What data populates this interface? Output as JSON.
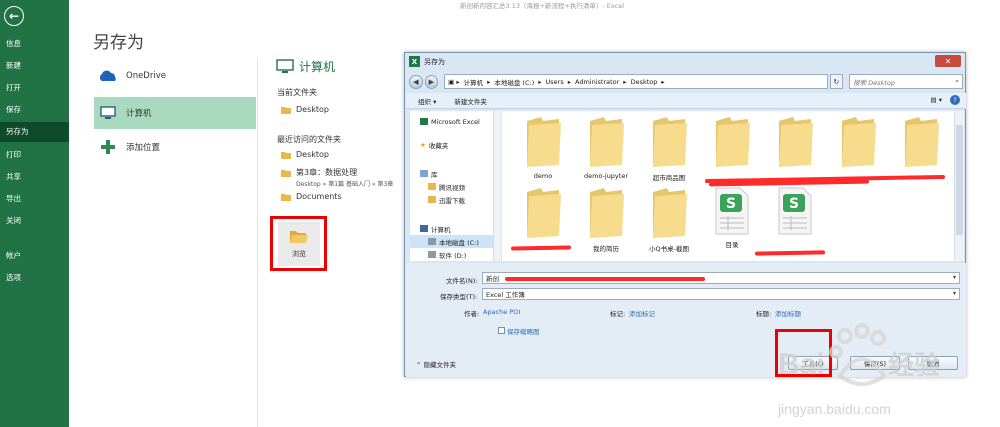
{
  "app": {
    "title": "新创新内容汇总3.13（海报+新流程+执行清单）- Excel",
    "page_title": "另存为"
  },
  "sidebar": {
    "items": [
      {
        "label": "信息"
      },
      {
        "label": "新建"
      },
      {
        "label": "打开"
      },
      {
        "label": "保存"
      },
      {
        "label": "另存为"
      },
      {
        "label": "打印"
      },
      {
        "label": "共享"
      },
      {
        "label": "导出"
      },
      {
        "label": "关闭"
      },
      {
        "label": "帐户"
      },
      {
        "label": "选项"
      }
    ],
    "active": "另存为"
  },
  "locations": [
    {
      "label": "OneDrive",
      "icon": "cloud-icon"
    },
    {
      "label": "计算机",
      "icon": "computer-icon"
    },
    {
      "label": "添加位置",
      "icon": "plus-icon"
    }
  ],
  "computer_pane": {
    "heading": "计算机",
    "current_folder_label": "当前文件夹",
    "current_folder": "Desktop",
    "recent_label": "最近访问的文件夹",
    "recent": [
      {
        "name": "Desktop"
      },
      {
        "name": "第3章：数据处理",
        "path": "Desktop » 第1篇 基础入门 » 第3章"
      },
      {
        "name": "Documents"
      }
    ],
    "browse_label": "浏览"
  },
  "dialog": {
    "title": "另存为",
    "address": [
      "计算机",
      "本地磁盘 (C:)",
      "Users",
      "Administrator",
      "Desktop"
    ],
    "search_placeholder": "搜索 Desktop",
    "toolbar": {
      "organize": "组织 ▾",
      "new_folder": "新建文件夹"
    },
    "tree": [
      {
        "label": "Microsoft Excel",
        "icon": "excel-icon",
        "indent": false
      },
      {
        "label": "收藏夹",
        "icon": "star-icon",
        "indent": false
      },
      {
        "label": "库",
        "icon": "library-icon",
        "indent": false
      },
      {
        "label": "腾讯视频",
        "icon": "folder-icon",
        "indent": true
      },
      {
        "label": "迅雷下载",
        "icon": "folder-icon",
        "indent": true
      },
      {
        "label": "计算机",
        "icon": "computer-icon",
        "indent": false
      },
      {
        "label": "本地磁盘 (C:)",
        "icon": "drive-icon",
        "indent": true,
        "selected": true
      },
      {
        "label": "软件 (D:)",
        "icon": "drive-icon",
        "indent": true
      }
    ],
    "files": [
      {
        "label": "demo",
        "type": "folder"
      },
      {
        "label": "demo-jupyter",
        "type": "folder"
      },
      {
        "label": "超市商品图",
        "type": "folder"
      },
      {
        "label": "",
        "type": "folder"
      },
      {
        "label": "",
        "type": "folder"
      },
      {
        "label": "",
        "type": "folder"
      },
      {
        "label": "",
        "type": "folder"
      },
      {
        "label": "",
        "type": "folder"
      },
      {
        "label": "我的简历",
        "type": "folder"
      },
      {
        "label": "小Q书桌-截图",
        "type": "folder"
      },
      {
        "label": "目录",
        "type": "sheet"
      },
      {
        "label": "",
        "type": "sheet"
      }
    ],
    "filename_label": "文件名(N):",
    "filename_value": "新创",
    "filetype_label": "保存类型(T):",
    "filetype_value": "Excel 工作簿",
    "author_label": "作者:",
    "author_value": "Apache POI",
    "tags_label": "标记:",
    "tags_value": "添加标记",
    "title_label": "标题:",
    "title_value": "添加标题",
    "thumbnail_label": "保存缩略图",
    "hide_folders": "隐藏文件夹",
    "tools_btn": "工具(L)",
    "save_btn": "保存(S)",
    "cancel_btn": "取消"
  },
  "watermark": {
    "brand": "Bai",
    "brand2": "经验",
    "url": "jingyan.baidu.com"
  }
}
